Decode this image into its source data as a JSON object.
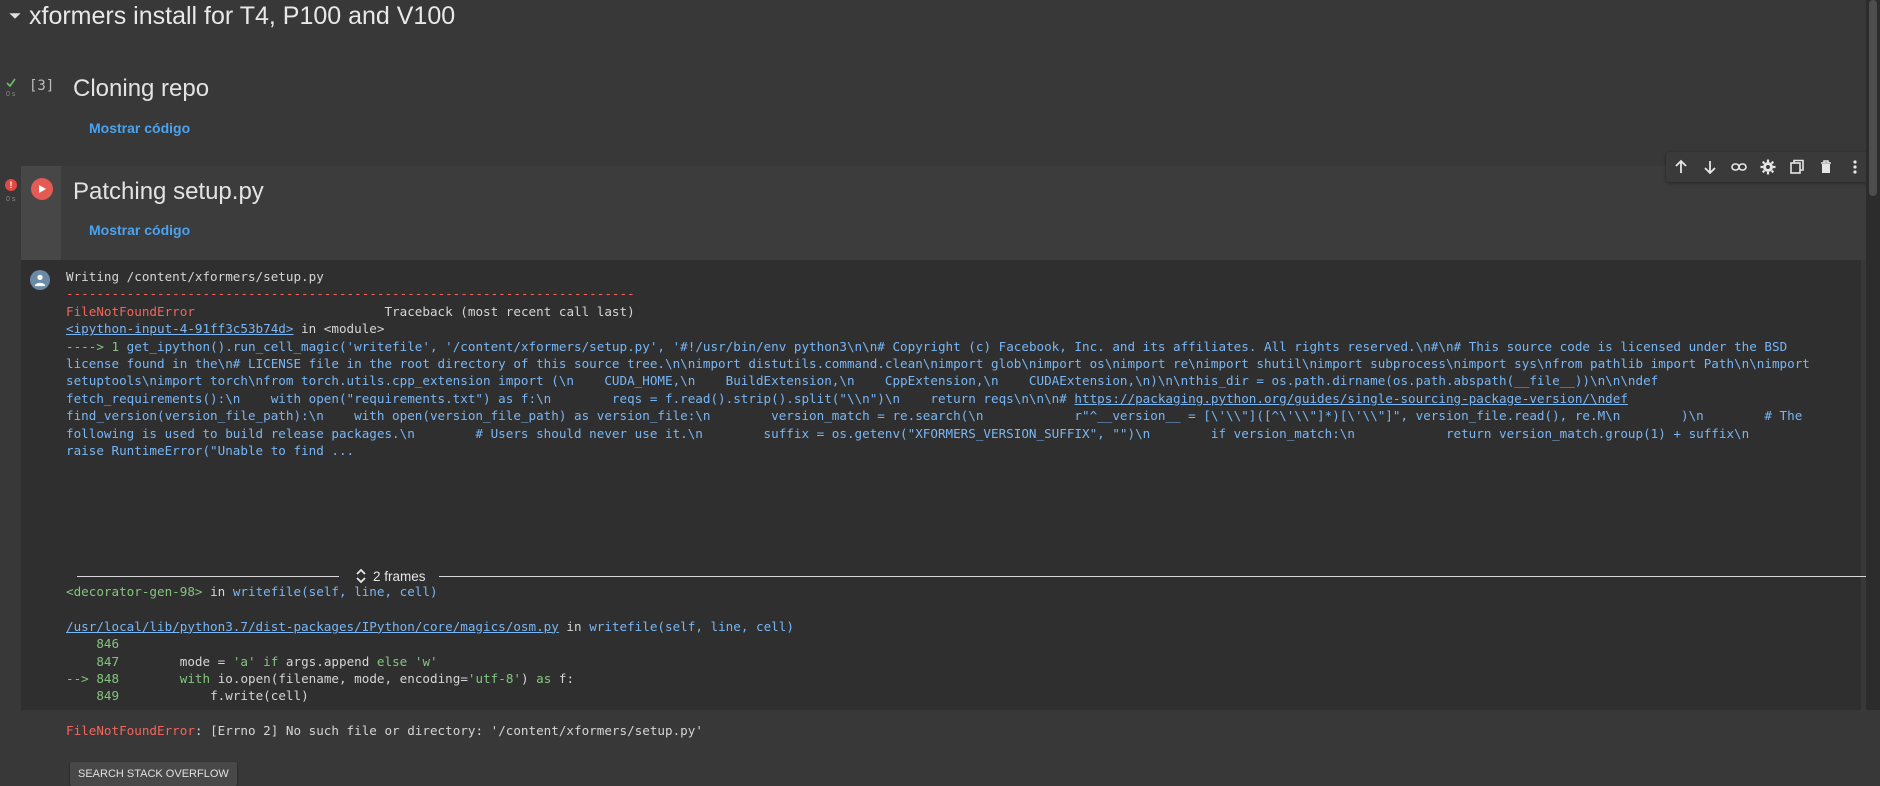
{
  "section": {
    "title": "xformers install for T4, P100 and V100"
  },
  "cell1": {
    "exec_count": "[3]",
    "small": "0 s",
    "title": "Cloning repo",
    "show_code": "Mostrar código"
  },
  "cell2": {
    "small": "0 s",
    "title": "Patching setup.py",
    "show_code": "Mostrar código",
    "toolbar": [
      "arrow-up-icon",
      "arrow-down-icon",
      "link-icon",
      "gear-icon",
      "mirror-icon",
      "trash-icon",
      "more-icon"
    ]
  },
  "output": {
    "writing": "Writing /content/xformers/setup.py",
    "dashes": "---------------------------------------------------------------------------",
    "error_name": "FileNotFoundError",
    "traceback_header": "Traceback (most recent call last)",
    "input_link": "<ipython-input-4-91ff3c53b74d>",
    "in_module": " in <module>",
    "arrow1": "----> 1 ",
    "call_line": [
      "get_ipython().run_cell_magic('writefile', '/content/xformers/setup.py', '#!/usr/bin/env python3\\n\\n# Copyright (c) Facebook, Inc. and its affiliates. All rights reserved.\\n#\\n# This source code is licensed under the BSD",
      "license found in the\\n# LICENSE file in the root directory of this source tree.\\n\\nimport distutils.command.clean\\nimport glob\\nimport os\\nimport re\\nimport shutil\\nimport subprocess\\nimport sys\\nfrom pathlib import Path\\n\\nimport",
      "setuptools\\nimport torch\\nfrom torch.utils.cpp_extension import (\\n    CUDA_HOME,\\n    BuildExtension,\\n    CppExtension,\\n    CUDAExtension,\\n)\\n\\nthis_dir = os.path.dirname(os.path.abspath(__file__))\\n\\n\\ndef",
      "fetch_requirements():\\n    with open(\"requirements.txt\") as f:\\n        reqs = f.read().strip().split(\"\\\\n\")\\n    return reqs\\n\\n\\n# "
    ],
    "call_link": "https://packaging.python.org/guides/single-sourcing-package-version/\\ndef",
    "call_line_rest": [
      "find_version(version_file_path):\\n    with open(version_file_path) as version_file:\\n        version_match = re.search(\\n            r\"^__version__ = [\\'\\\\\"]([^\\'\\\\\"]*)[\\'\\\\\"]\", version_file.read(), re.M\\n        )\\n        # The",
      "following is used to build release packages.\\n        # Users should never use it.\\n        suffix = os.getenv(\"XFORMERS_VERSION_SUFFIX\", \"\")\\n        if version_match:\\n            return version_match.group(1) + suffix\\n",
      "raise RuntimeError(\"Unable to find ..."
    ],
    "frames_label": "2 frames",
    "decorator": "<decorator-gen-98>",
    "in_writefile": " in ",
    "writefile_sig": "writefile(self, line, cell)",
    "osm_link": "/usr/local/lib/python3.7/dist-packages/IPython/core/magics/osm.py",
    "code_lines": [
      {
        "prefix": "    ",
        "num": "846",
        "code": ""
      },
      {
        "prefix": "    ",
        "num": "847",
        "code": "        mode = 'a' if args.append else 'w'"
      },
      {
        "prefix": "--> ",
        "num": "848",
        "code": "        with io.open(filename, mode, encoding='utf-8') as f:"
      },
      {
        "prefix": "    ",
        "num": "849",
        "code": "            f.write(cell)"
      }
    ],
    "final_error_name": "FileNotFoundError",
    "final_error_msg": ": [Errno 2] No such file or directory: '/content/xformers/setup.py'",
    "so_button": "SEARCH STACK OVERFLOW"
  },
  "colors": {
    "background": "#383838",
    "error": "#f4655c",
    "link": "#78b6f5",
    "accent": "#4aa3f0",
    "run": "#e35b54"
  }
}
